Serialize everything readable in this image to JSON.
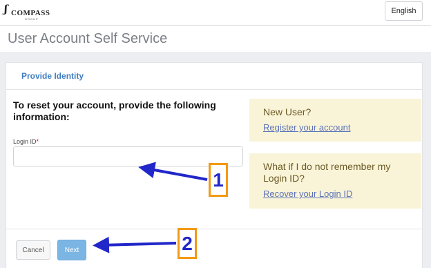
{
  "header": {
    "logo": {
      "mark": "ʃ",
      "name": "COMPASS",
      "sub": "GROUP"
    },
    "language_button": "English"
  },
  "page": {
    "title": "User Account Self Service"
  },
  "card": {
    "tab_label": "Provide Identity",
    "instructions": "To reset your account, provide the following information:",
    "login_field": {
      "label": "Login ID",
      "required_marker": "*",
      "value": "",
      "placeholder": ""
    },
    "new_user": {
      "title": "New User?",
      "link": "Register your account"
    },
    "forgot": {
      "title": "What if I do not remember my Login ID?",
      "link": "Recover your Login ID"
    },
    "buttons": {
      "cancel": "Cancel",
      "next": "Next"
    }
  },
  "annotations": [
    {
      "number": "1"
    },
    {
      "number": "2"
    }
  ],
  "colors": {
    "accent": "#3e7dc1",
    "next_button": "#7bb5e3",
    "info_box": "#f9f4d8",
    "callout_border": "#f29a14",
    "arrow": "#2127c8"
  }
}
